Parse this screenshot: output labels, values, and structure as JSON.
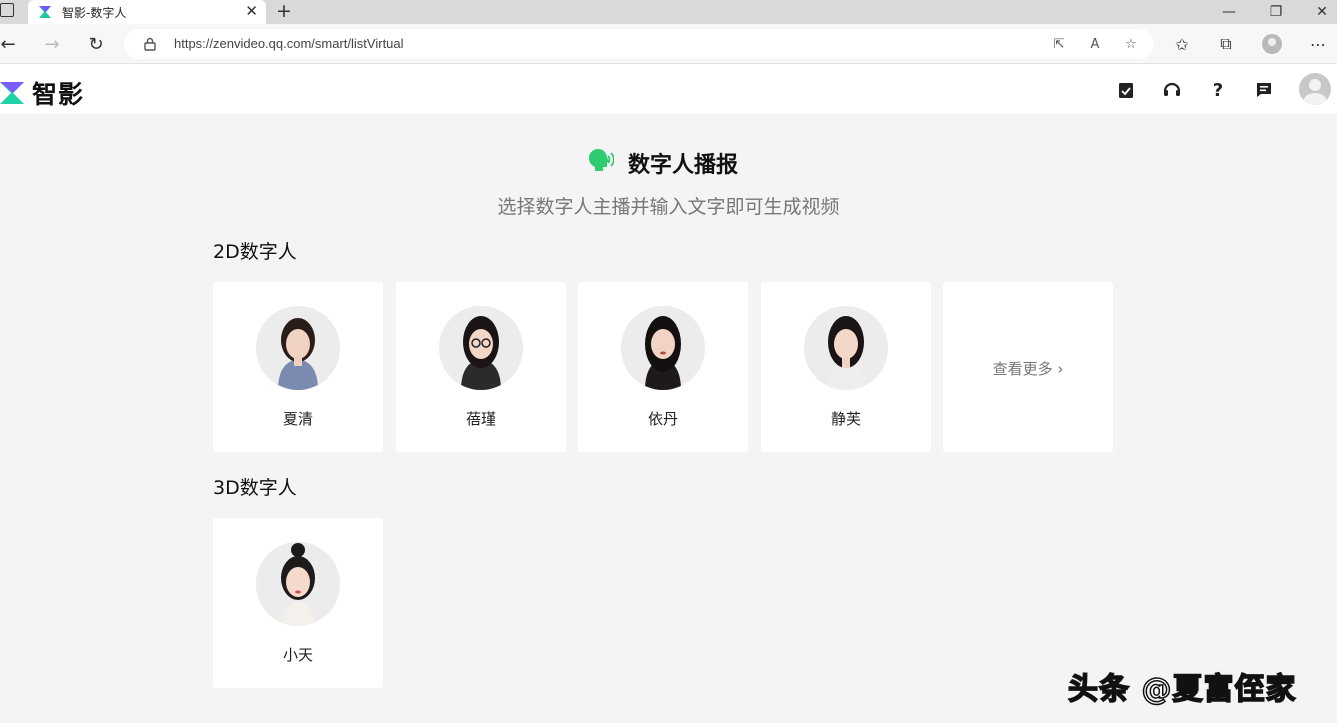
{
  "browser": {
    "tab_title": "智影-数字人",
    "url": "https://zenvideo.qq.com/smart/listVirtual",
    "window_controls": [
      "minimize-icon",
      "restore-icon",
      "close-icon"
    ]
  },
  "app": {
    "logo_text": "智影",
    "header_icons": [
      "clipboard-check-icon",
      "headset-icon",
      "help-icon",
      "message-icon"
    ]
  },
  "hero": {
    "title": "数字人播报",
    "subtitle": "选择数字人主播并输入文字即可生成视频",
    "accent_color": "#2ecc71"
  },
  "sections": {
    "d2": {
      "title": "2D数字人",
      "items": [
        {
          "name": "夏清"
        },
        {
          "name": "蓓瑾"
        },
        {
          "name": "依丹"
        },
        {
          "name": "静芙"
        }
      ],
      "more_label": "查看更多"
    },
    "d3": {
      "title": "3D数字人",
      "items": [
        {
          "name": "小天"
        }
      ]
    }
  },
  "watermark": "头条 @夏富侄家"
}
